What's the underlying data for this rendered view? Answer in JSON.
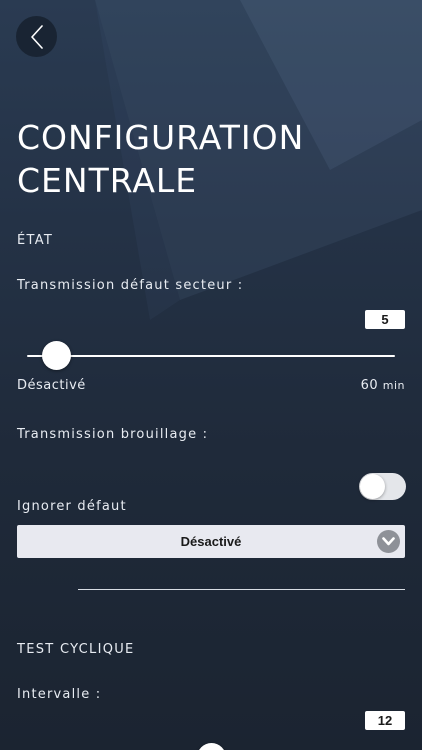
{
  "header": {
    "back_icon": "chevron-left-icon",
    "title_line1": "CONFIGURATION",
    "title_line2": "CENTRALE"
  },
  "etat": {
    "section_label": "ÉTAT",
    "transmission_secteur": {
      "label": "Transmission défaut secteur :",
      "value": "5",
      "value_fraction": 0.08,
      "min_label": "Désactivé",
      "max_value": "60",
      "max_unit": "min"
    },
    "transmission_brouillage": {
      "label": "Transmission brouillage :",
      "toggle_on": false
    },
    "ignorer_defaut": {
      "label": "Ignorer défaut",
      "selected": "Désactivé",
      "dropdown_icon": "chevron-down-icon"
    }
  },
  "test_cyclique": {
    "section_label": "TEST CYCLIQUE",
    "intervalle": {
      "label": "Intervalle :",
      "value": "12",
      "value_fraction": 0.5
    }
  },
  "colors": {
    "background_top": "#2a3b52",
    "background_bottom": "#1b2431",
    "control_light": "#e8e9f0",
    "chevron_circle": "#8e9198"
  }
}
